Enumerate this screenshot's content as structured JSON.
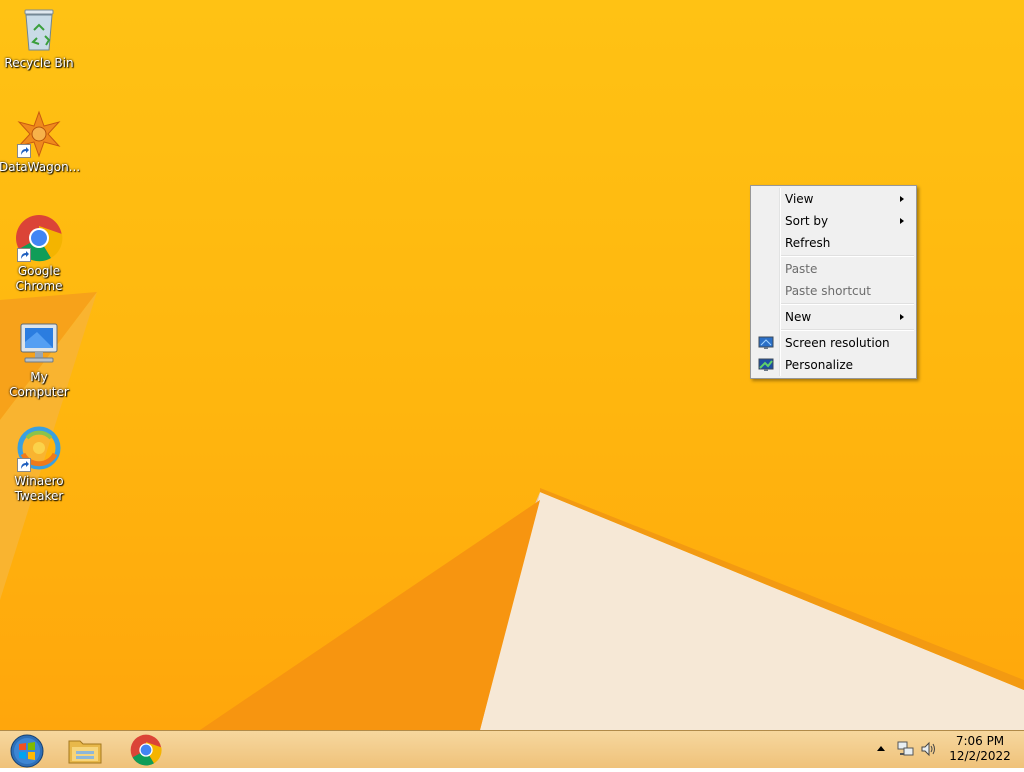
{
  "desktop": {
    "icons": [
      {
        "label": "Recycle Bin",
        "icon": "recycle-bin-icon",
        "shortcut": false
      },
      {
        "label": "DataWagon...",
        "icon": "datawagon-icon",
        "shortcut": true
      },
      {
        "label": "Google Chrome",
        "icon": "chrome-icon",
        "shortcut": true
      },
      {
        "label": "My Computer",
        "icon": "computer-icon",
        "shortcut": false
      },
      {
        "label": "Winaero Tweaker",
        "icon": "winaero-tweaker-icon",
        "shortcut": true
      }
    ]
  },
  "context_menu": {
    "items": [
      {
        "label": "View",
        "submenu": true,
        "enabled": true
      },
      {
        "label": "Sort by",
        "submenu": true,
        "enabled": true
      },
      {
        "label": "Refresh",
        "submenu": false,
        "enabled": true
      },
      {
        "label": "Paste",
        "submenu": false,
        "enabled": false
      },
      {
        "label": "Paste shortcut",
        "submenu": false,
        "enabled": false
      },
      {
        "label": "New",
        "submenu": true,
        "enabled": true
      },
      {
        "label": "Screen resolution",
        "submenu": false,
        "enabled": true,
        "icon": "screen-resolution-icon"
      },
      {
        "label": "Personalize",
        "submenu": false,
        "enabled": true,
        "icon": "personalize-icon"
      }
    ]
  },
  "taskbar": {
    "buttons": [
      {
        "icon": "start-orb-icon"
      },
      {
        "icon": "file-explorer-icon"
      },
      {
        "icon": "chrome-icon"
      }
    ],
    "tray": {
      "icons": [
        "show-hidden-icons-arrow",
        "network-icon",
        "volume-icon"
      ],
      "time": "7:06 PM",
      "date": "12/2/2022"
    }
  },
  "colors": {
    "wallpaper_yellow": "#ffbb10",
    "wallpaper_orange": "#f7a215",
    "wallpaper_cream": "#f5e6d2",
    "taskbar": "#f2cb86",
    "menu_bg": "#f0f0f0",
    "disabled_text": "#6d6d6d"
  }
}
